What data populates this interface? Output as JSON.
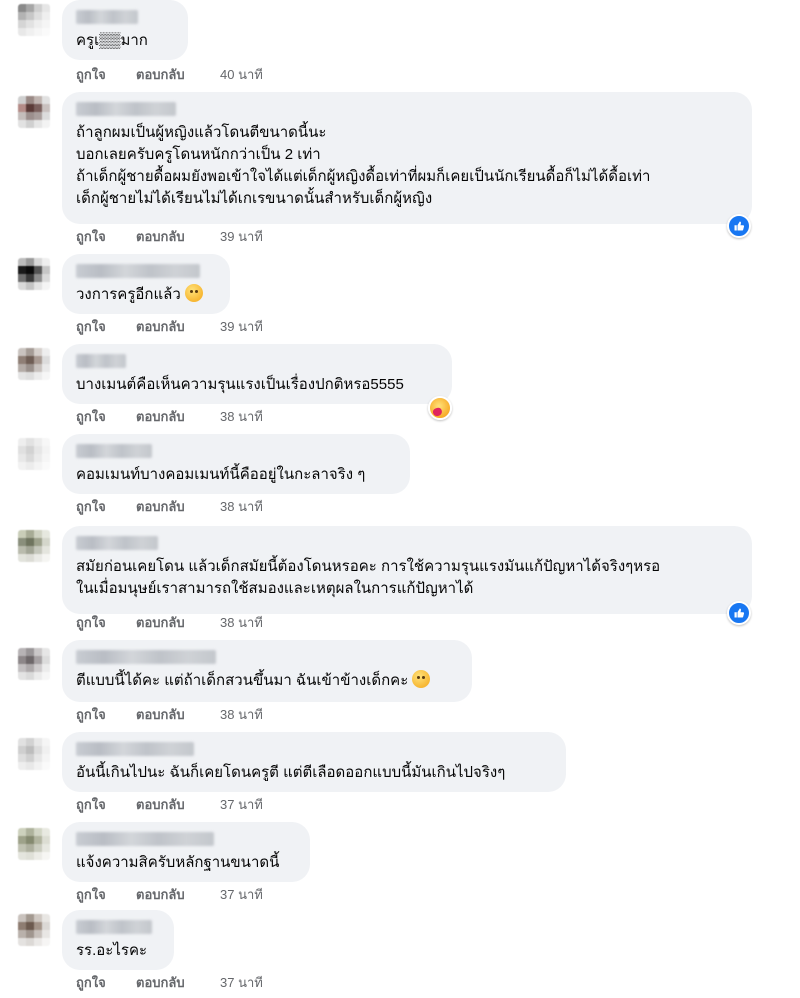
{
  "colors": {
    "bubble": "#f0f2f5",
    "text": "#050505",
    "meta": "#65676b",
    "like_blue": "#1877f2"
  },
  "comments": [
    {
      "text": "ครูเ▒▒มาก",
      "like": "ถูกใจ",
      "reply": "ตอบกลับ",
      "time": "40 นาที"
    },
    {
      "text": "ถ้าลูกผมเป็นผู้หญิงแล้วโดนตีขนาดนี้นะ\nบอกเลยครับครูโดนหนักกว่าเป็น 2 เท่า\nถ้าเด็กผู้ชายดื้อผมยังพอเข้าใจได้แต่เด็กผู้หญิงดื้อเท่าที่ผมก็เคยเป็นนักเรียนดื้อก็ไม่ได้ดื้อเท่า\nเด็กผู้ชายไม่ได้เรียนไม่ได้เกเรขนาดนั้นสำหรับเด็กผู้หญิง",
      "like": "ถูกใจ",
      "reply": "ตอบกลับ",
      "time": "39 นาที",
      "reaction": "like-reaction-icon"
    },
    {
      "text": "วงการครูอีกแล้ว",
      "like": "ถูกใจ",
      "reply": "ตอบกลับ",
      "time": "39 นาที",
      "emoji": "rolling-eyes-emoji"
    },
    {
      "text": "บางเมนต์คือเห็นความรุนแรงเป็นเรื่องปกติหรอ5555",
      "like": "ถูกใจ",
      "reply": "ตอบกลับ",
      "time": "38 นาที",
      "reaction": "haha-reaction-icon"
    },
    {
      "text": "คอมเมนท์บางคอมเมนท์นี้คืออยู่ในกะลาจริง ๆ",
      "like": "ถูกใจ",
      "reply": "ตอบกลับ",
      "time": "38 นาที"
    },
    {
      "text": "สมัยก่อนเคยโดน แล้วเด็กสมัยนี้ต้องโดนหรอคะ การใช้ความรุนแรงมันแก้ปัญหาได้จริงๆหรอ\nในเมื่อมนุษย์เราสามารถใช้สมองและเหตุผลในการแก้ปัญหาได้",
      "like": "ถูกใจ",
      "reply": "ตอบกลับ",
      "time": "38 นาที",
      "reaction": "like-reaction-icon"
    },
    {
      "text": "ตีแบบนี้ได้คะ แต่ถ้าเด็กสวนขึ้นมา ฉันเข้าข้างเด็กคะ",
      "like": "ถูกใจ",
      "reply": "ตอบกลับ",
      "time": "38 นาที",
      "emoji": "relieved-face-emoji"
    },
    {
      "text": "อันนี้เกินไปนะ ฉันก็เคยโดนครูตี แต่ตีเลือดออกแบบนี้มันเกินไปจริงๆ",
      "like": "ถูกใจ",
      "reply": "ตอบกลับ",
      "time": "37 นาที"
    },
    {
      "text": "แจ้งความสิครับหลักฐานขนาดนี้",
      "like": "ถูกใจ",
      "reply": "ตอบกลับ",
      "time": "37 นาที"
    },
    {
      "text": "รร.อะไรคะ",
      "like": "ถูกใจ",
      "reply": "ตอบกลับ",
      "time": "37 นาที"
    }
  ]
}
